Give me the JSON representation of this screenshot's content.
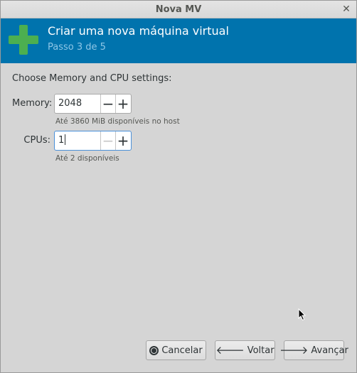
{
  "window": {
    "title": "Nova MV",
    "close_glyph": "✕"
  },
  "header": {
    "icon": "green-plus-icon",
    "title": "Criar uma nova máquina virtual",
    "step": "Passo 3 de 5",
    "colors": {
      "background": "#0073ad",
      "subtitle": "#8ec6e6",
      "icon": "#4caf50"
    }
  },
  "section_label": "Choose Memory and CPU settings:",
  "memory": {
    "label": "Memory:",
    "value": "2048",
    "hint": "Até 3860 MiB disponíveis no host",
    "minus": "−",
    "plus": "+"
  },
  "cpus": {
    "label": "CPUs:",
    "value": "1",
    "hint": "Até 2 disponíveis",
    "minus": "−",
    "plus": "+"
  },
  "buttons": {
    "cancel": "Cancelar",
    "back": "Voltar",
    "forward": "Avançar",
    "back_arrow": "🡐",
    "forward_arrow": "🡒"
  }
}
